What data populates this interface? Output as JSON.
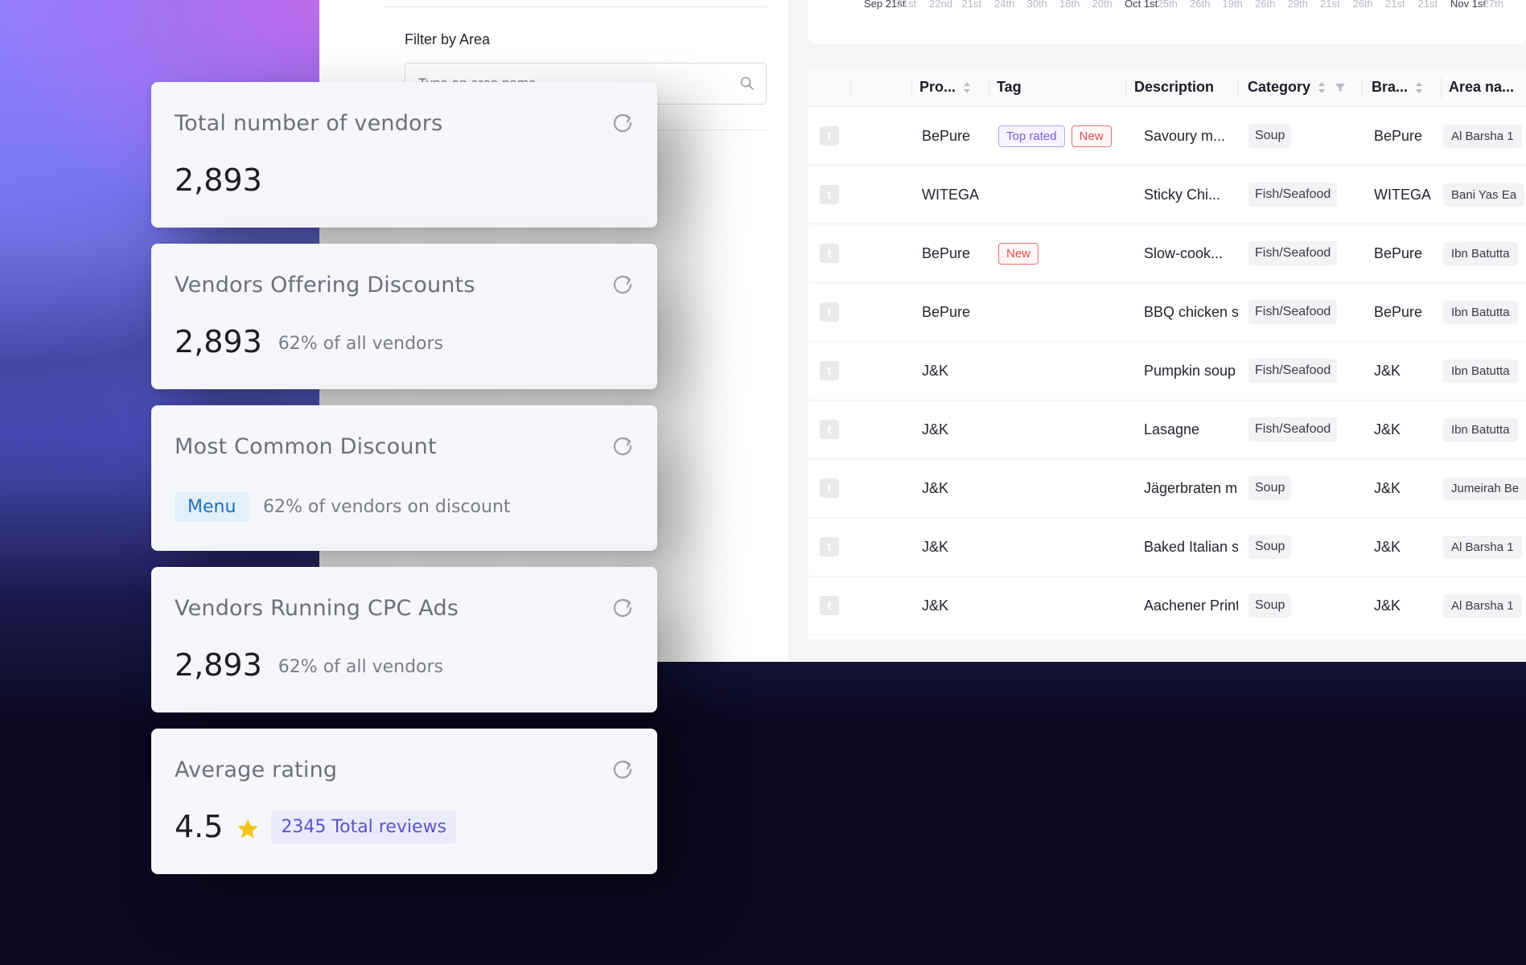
{
  "filter": {
    "label": "Filter by Area",
    "placeholder": "Type an area name"
  },
  "timeline": {
    "ticks": [
      {
        "label": "Sep 21st",
        "major": true
      },
      {
        "label": "21st",
        "major": false
      },
      {
        "label": "22nd",
        "major": false
      },
      {
        "label": "21st",
        "major": false
      },
      {
        "label": "24th",
        "major": false
      },
      {
        "label": "30th",
        "major": false
      },
      {
        "label": "18th",
        "major": false
      },
      {
        "label": "20th",
        "major": false
      },
      {
        "label": "Oct 1st",
        "major": true
      },
      {
        "label": "25th",
        "major": false
      },
      {
        "label": "26th",
        "major": false
      },
      {
        "label": "19th",
        "major": false
      },
      {
        "label": "26th",
        "major": false
      },
      {
        "label": "29th",
        "major": false
      },
      {
        "label": "21st",
        "major": false
      },
      {
        "label": "26th",
        "major": false
      },
      {
        "label": "21st",
        "major": false
      },
      {
        "label": "21st",
        "major": false
      },
      {
        "label": "Nov 1st",
        "major": true
      },
      {
        "label": "27th",
        "major": false
      }
    ]
  },
  "table": {
    "columns": {
      "provider": "Pro...",
      "tag": "Tag",
      "description": "Description",
      "category": "Category",
      "brand": "Bra...",
      "area": "Area na..."
    },
    "rows": [
      {
        "icon": "t",
        "provider": "BePure",
        "tags": [
          {
            "text": "Top rated",
            "color": "purple"
          },
          {
            "text": "New",
            "color": "red"
          }
        ],
        "description": "Savoury m...",
        "category": "Soup",
        "brand": "BePure",
        "area": "Al Barsha 1"
      },
      {
        "icon": "t",
        "provider": "WITEGA",
        "tags": [],
        "description": "Sticky Chi...",
        "category": "Fish/Seafood",
        "brand": "WITEGA",
        "area": "Bani Yas Ea"
      },
      {
        "icon": "t",
        "provider": "BePure",
        "tags": [
          {
            "text": "New",
            "color": "red"
          }
        ],
        "description": "Slow-cook...",
        "category": "Fish/Seafood",
        "brand": "BePure",
        "area": "Ibn Batutta"
      },
      {
        "icon": "t",
        "provider": "BePure",
        "tags": [],
        "description": "BBQ chicken s",
        "category": "Fish/Seafood",
        "brand": "BePure",
        "area": "Ibn Batutta"
      },
      {
        "icon": "t",
        "provider": "J&K",
        "tags": [],
        "description": "Pumpkin soup",
        "category": "Fish/Seafood",
        "brand": "J&K",
        "area": "Ibn Batutta"
      },
      {
        "icon": "t",
        "provider": "J&K",
        "tags": [],
        "description": "Lasagne",
        "category": "Fish/Seafood",
        "brand": "J&K",
        "area": "Ibn Batutta"
      },
      {
        "icon": "t",
        "provider": "J&K",
        "tags": [],
        "description": "Jägerbraten m",
        "category": "Soup",
        "brand": "J&K",
        "area": "Jumeirah Be"
      },
      {
        "icon": "t",
        "provider": "J&K",
        "tags": [],
        "description": "Baked Italian s",
        "category": "Soup",
        "brand": "J&K",
        "area": "Al Barsha 1"
      },
      {
        "icon": "t",
        "provider": "J&K",
        "tags": [],
        "description": "Aachener Print",
        "category": "Soup",
        "brand": "J&K",
        "area": "Al Barsha 1"
      }
    ]
  },
  "cards": {
    "total_vendors": {
      "title": "Total number of vendors",
      "value": "2,893"
    },
    "discounts": {
      "title": "Vendors Offering Discounts",
      "value": "2,893",
      "sub": "62% of all vendors"
    },
    "common_discount": {
      "title": "Most Common Discount",
      "chip": "Menu",
      "sub": "62% of vendors on discount"
    },
    "cpc_ads": {
      "title": "Vendors Running CPC Ads",
      "value": "2,893",
      "sub": "62% of all vendors"
    },
    "rating": {
      "title": "Average rating",
      "value": "4.5",
      "reviews": "2345 Total reviews"
    }
  },
  "icons": {
    "refresh": "refresh-icon",
    "search": "search-icon",
    "star": "star-icon",
    "sort": "sort-icon",
    "filter": "filter-icon"
  },
  "colors": {
    "tag_purple": "#7e5bd6",
    "tag_red": "#e24b4b",
    "star": "#f5c518",
    "chip_menu_bg": "#e2f0fb",
    "chip_reviews_bg": "#ebeafc"
  }
}
